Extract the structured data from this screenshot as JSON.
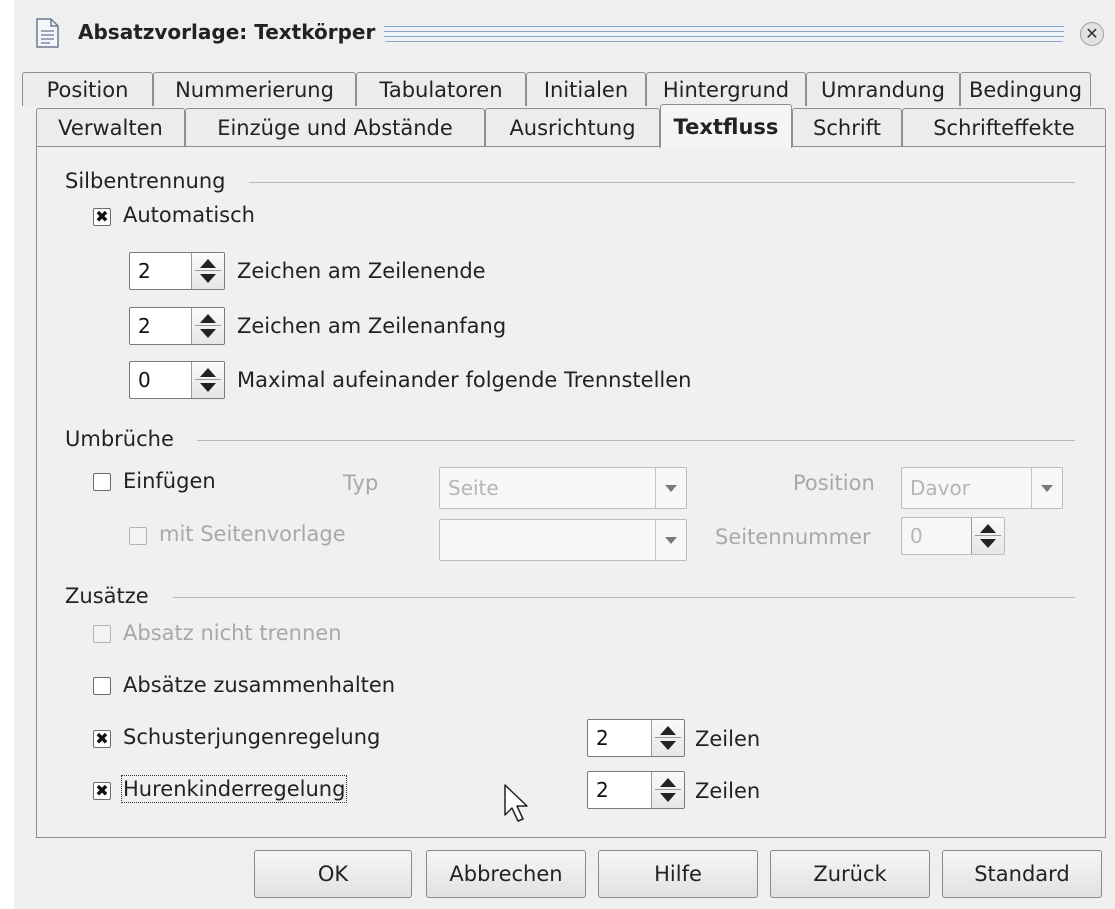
{
  "window": {
    "title": "Absatzvorlage: Textkörper",
    "close_icon": "close-icon"
  },
  "tabs_row1": [
    "Position",
    "Nummerierung",
    "Tabulatoren",
    "Initialen",
    "Hintergrund",
    "Umrandung",
    "Bedingung"
  ],
  "tabs_row2": [
    "Verwalten",
    "Einzüge und Abstände",
    "Ausrichtung",
    "Textfluss",
    "Schrift",
    "Schrifteffekte"
  ],
  "active_tab": "Textfluss",
  "hyphenation": {
    "section": "Silbentrennung",
    "automatic": {
      "label": "Automatisch",
      "checked": true
    },
    "chars_line_end": {
      "value": "2",
      "label": "Zeichen am Zeilenende"
    },
    "chars_line_begin": {
      "value": "2",
      "label": "Zeichen am Zeilenanfang"
    },
    "max_consecutive": {
      "value": "0",
      "label": "Maximal aufeinander folgende Trennstellen"
    }
  },
  "breaks": {
    "section": "Umbrüche",
    "insert": {
      "label": "Einfügen",
      "checked": false
    },
    "type_label": "Typ",
    "type_value": "Seite",
    "position_label": "Position",
    "position_value": "Davor",
    "with_page_style": {
      "label": "mit Seitenvorlage",
      "checked": false
    },
    "page_style_value": "",
    "page_number_label": "Seitennummer",
    "page_number_value": "0"
  },
  "options": {
    "section": "Zusätze",
    "keep_together": {
      "label": "Absatz nicht trennen",
      "checked": false
    },
    "keep_with_next": {
      "label": "Absätze zusammenhalten",
      "checked": false
    },
    "orphan": {
      "label": "Schusterjungenregelung",
      "checked": true,
      "value": "2",
      "unit": "Zeilen"
    },
    "widow": {
      "label": "Hurenkinderregelung",
      "checked": true,
      "value": "2",
      "unit": "Zeilen"
    }
  },
  "buttons": {
    "ok": "OK",
    "cancel": "Abbrechen",
    "help": "Hilfe",
    "back": "Zurück",
    "default": "Standard"
  },
  "check_mark": "✖"
}
